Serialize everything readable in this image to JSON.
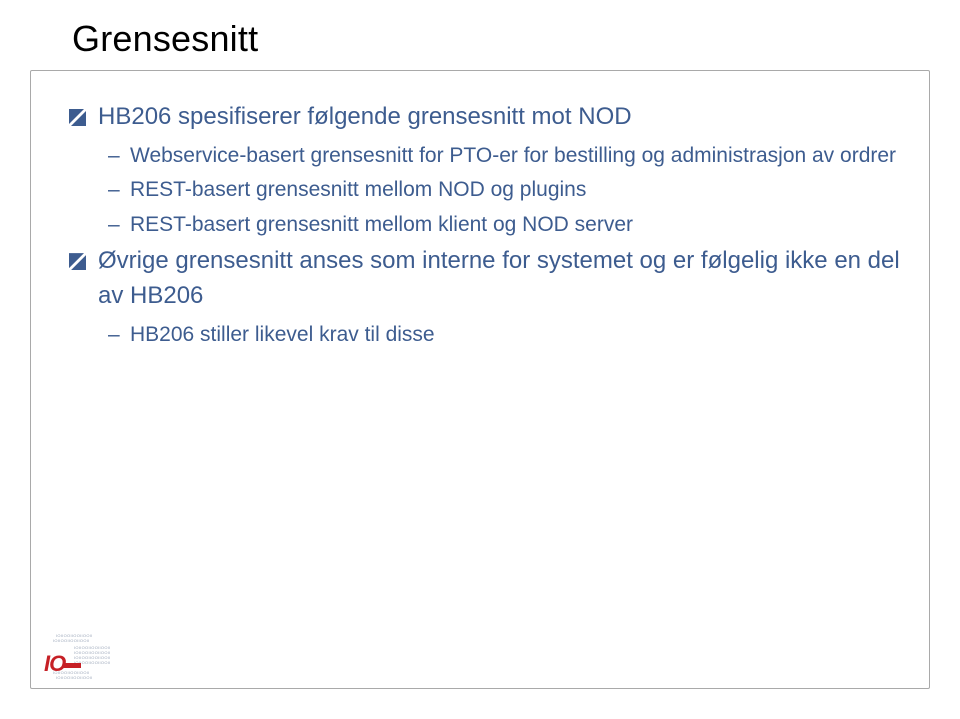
{
  "title": "Grensesnitt",
  "bullets": [
    {
      "level": 1,
      "text": "HB206 spesifiserer følgende grensesnitt mot NOD"
    },
    {
      "level": 2,
      "text": "Webservice-basert grensesnitt for PTO-er for bestilling og administrasjon av ordrer"
    },
    {
      "level": 2,
      "text": "REST-basert grensesnitt mellom NOD og plugins"
    },
    {
      "level": 2,
      "text": "REST-basert grensesnitt mellom klient og NOD server"
    },
    {
      "level": 1,
      "text": "Øvrige grensesnitt anses som interne for systemet og er følgelig ikke en del av HB206"
    },
    {
      "level": 2,
      "text": "HB206 stiller likevel krav til disse"
    }
  ],
  "logo": {
    "text": "IO",
    "pattern": "IOIIOOIIOOIIOOII"
  }
}
